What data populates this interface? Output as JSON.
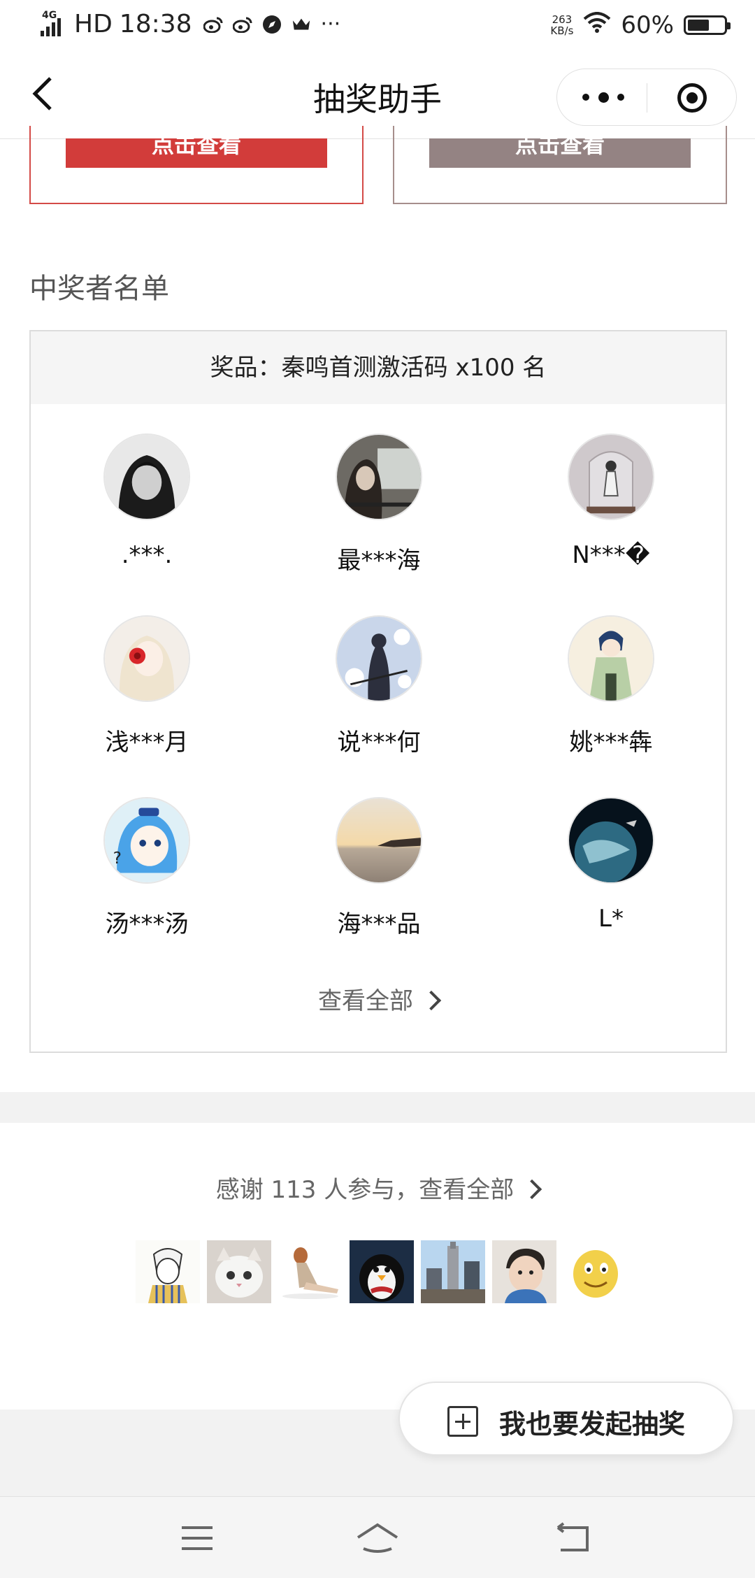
{
  "status_bar": {
    "network": "4G",
    "hd": "HD",
    "time": "18:38",
    "speed_value": "263",
    "speed_unit": "KB/s",
    "battery": "60%",
    "battery_level": 0.6,
    "more": "···"
  },
  "navbar": {
    "title": "抽奖助手"
  },
  "top_cards": {
    "left_button": "点击查看",
    "right_button": "点击查看"
  },
  "winners_section": {
    "title": "中奖者名单",
    "prize_label": "奖品：秦鸣首测激活码 x100 名",
    "winners": [
      {
        "name": ".***.",
        "avatar": "dark-anime-boy"
      },
      {
        "name": "最***海",
        "avatar": "anime-girl-window"
      },
      {
        "name": "N***�",
        "avatar": "figure-in-glass-dome"
      },
      {
        "name": "浅***月",
        "avatar": "white-hair-girl-rose"
      },
      {
        "name": "说***何",
        "avatar": "anime-girl-flowers"
      },
      {
        "name": "姚***犇",
        "avatar": "chibi-girl-hanfu"
      },
      {
        "name": "汤***汤",
        "avatar": "blue-hair-chibi"
      },
      {
        "name": "海***品",
        "avatar": "hand-sunset-sea"
      },
      {
        "name": "L*",
        "avatar": "earth-space"
      }
    ],
    "view_all": "查看全部"
  },
  "participants": {
    "thanks_text": "感谢 113 人参与，查看全部",
    "avatars": [
      "sketch-boy",
      "white-cat",
      "sitting-girl",
      "penguin",
      "city-towers",
      "toddler",
      "yellow-face"
    ]
  },
  "fab": {
    "label": "我也要发起抽奖"
  },
  "colors": {
    "primary_red": "#d23c3a",
    "muted_button": "#948383",
    "background_gray": "#f2f2f2"
  }
}
